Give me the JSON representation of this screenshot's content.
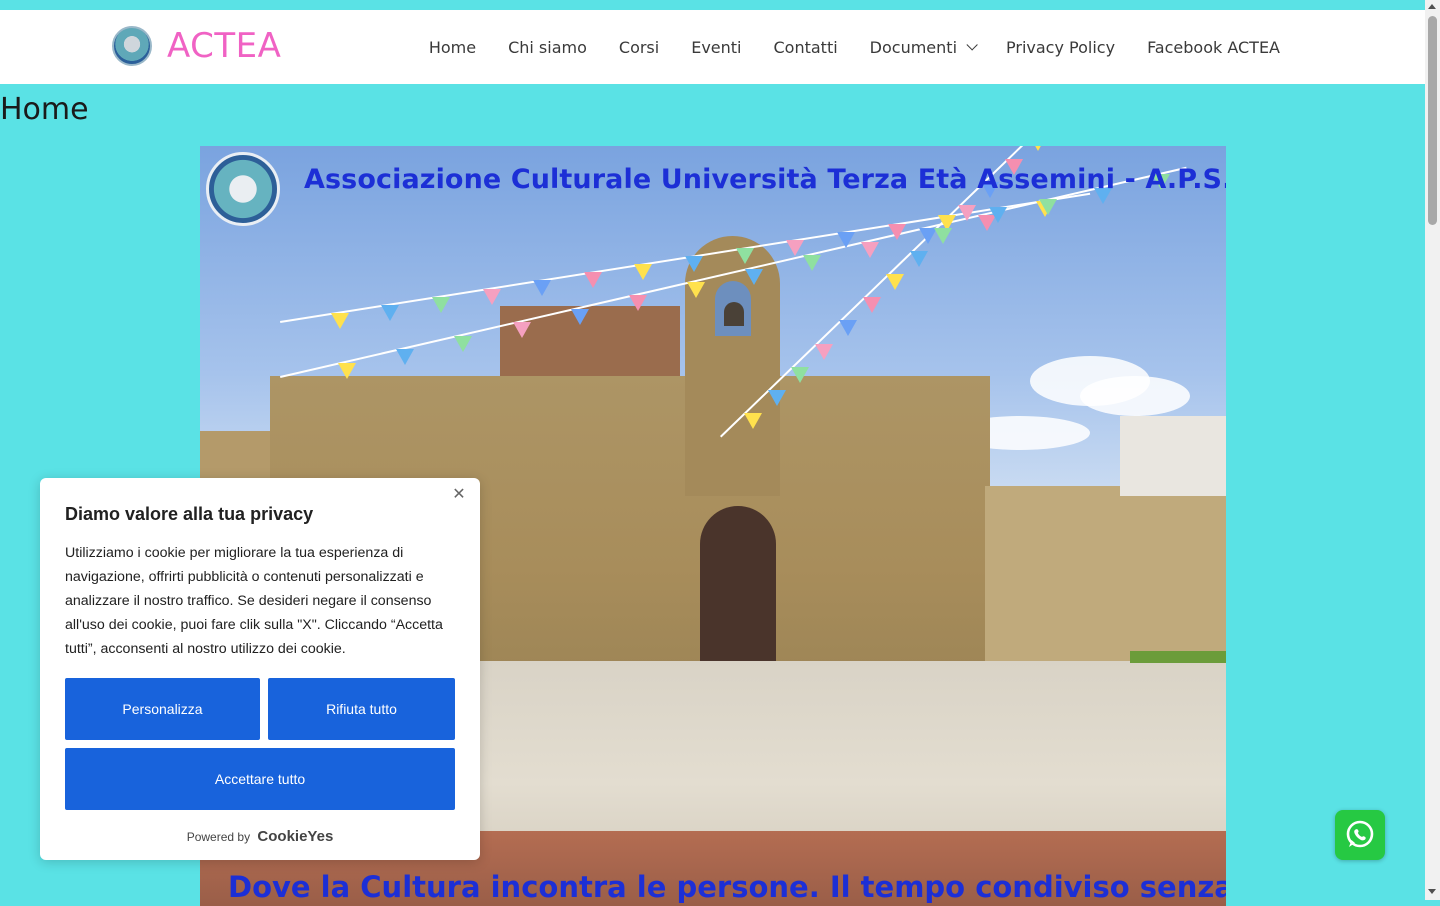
{
  "header": {
    "brand_name": "ACTEA",
    "nav": [
      "Home",
      "Chi siamo",
      "Corsi",
      "Eventi",
      "Contatti",
      "Documenti",
      "Privacy Policy",
      "Facebook ACTEA"
    ]
  },
  "page": {
    "title": "Home"
  },
  "hero": {
    "title": "Associazione Culturale Università Terza Età Assemini - A.P.S.",
    "tagline": "Dove la Cultura incontra le persone. Il tempo condiviso senza giudizi.",
    "image_subject": "stone church with bell tower and colorful bunting"
  },
  "cookie_banner": {
    "title": "Diamo valore alla tua privacy",
    "text": "Utilizziamo i cookie per migliorare la tua esperienza di navigazione, offrirti pubblicità o contenuti personalizzati e analizzare il nostro traffico. Se desideri negare il consenso all'uso dei cookie, puoi fare clik sulla \"X\". Cliccando “Accetta tutti”, acconsenti al nostro utilizzo dei cookie.",
    "customize_label": "Personalizza",
    "reject_label": "Rifiuta tutto",
    "accept_label": "Accettare tutto",
    "powered_by": "Powered by",
    "powered_brand": "CookieYes"
  },
  "colors": {
    "page_background": "#5ae2e5",
    "brand": "#f062c4",
    "cookie_button": "#1863dc",
    "hero_text": "#1c2fd6",
    "whatsapp": "#26c943"
  },
  "icons": {
    "dropdown": "chevron-down-icon",
    "close": "close-icon",
    "whatsapp": "whatsapp-icon"
  }
}
